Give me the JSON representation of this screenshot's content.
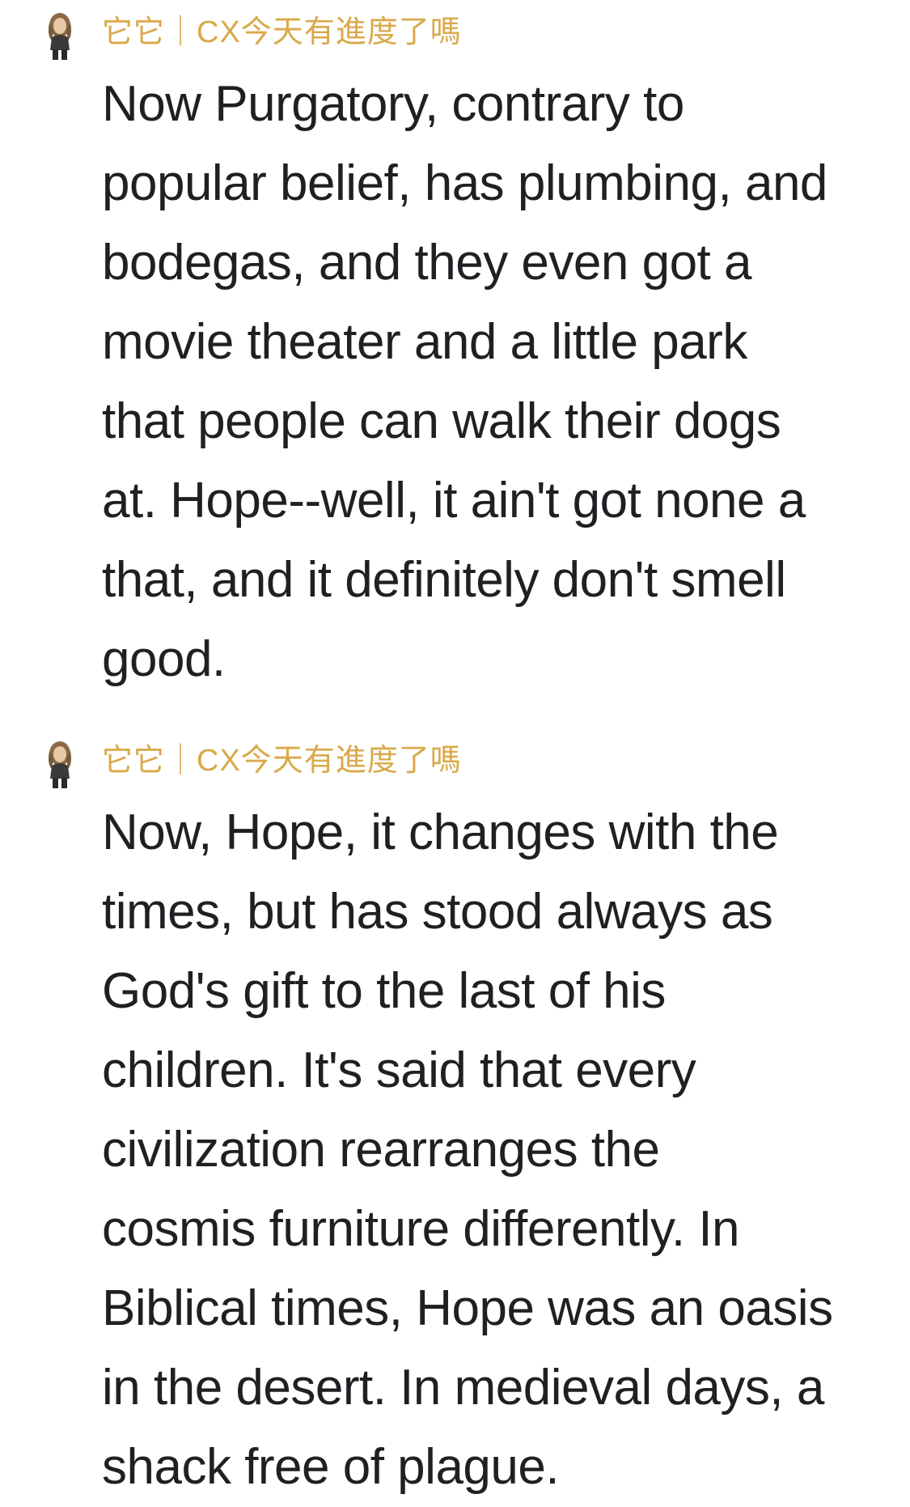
{
  "theme": {
    "sender_color": "#d9a94a",
    "text_color": "#1f1f24"
  },
  "messages": [
    {
      "avatar_icon": "user-avatar-icon",
      "sender": "它它｜CX今天有進度了嗎",
      "body": "Now Purgatory, contrary to\npopular belief, has plumbing, and\nbodegas, and they even got a\nmovie theater and a little park\nthat people can walk their dogs\nat. Hope--well, it ain't got none a\nthat, and it definitely don't smell\ngood."
    },
    {
      "avatar_icon": "user-avatar-icon",
      "sender": "它它｜CX今天有進度了嗎",
      "body": "Now, Hope, it changes with the\ntimes, but has stood always as\nGod's gift to the last of his\nchildren. It's said that every\ncivilization rearranges the\ncosmis furniture differently. In\nBiblical times, Hope was an oasis\nin the desert. In medieval days, a\nshack free of plague."
    }
  ]
}
